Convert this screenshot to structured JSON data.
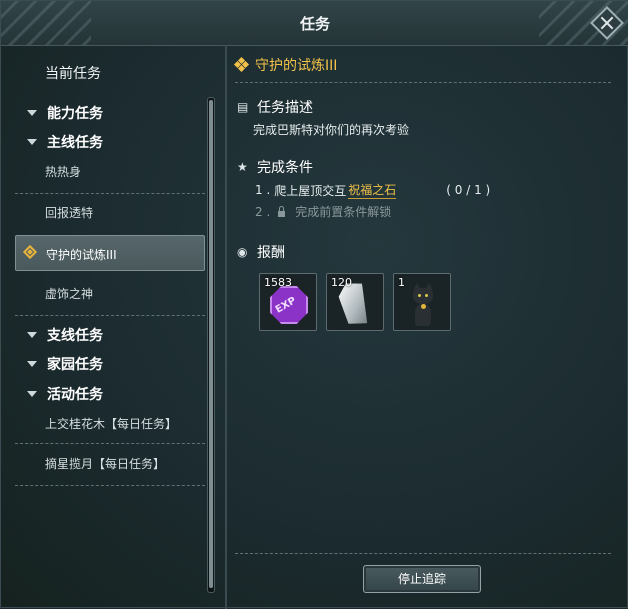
{
  "window": {
    "title": "任务"
  },
  "sidebar": {
    "current_label": "当前任务",
    "categories": [
      {
        "label": "能力任务"
      },
      {
        "label": "主线任务"
      },
      {
        "label": "支线任务"
      },
      {
        "label": "家园任务"
      },
      {
        "label": "活动任务"
      }
    ],
    "main_quests": [
      "热热身",
      "回报透特",
      "守护的试炼III",
      "虚饰之神"
    ],
    "event_quests": [
      "上交桂花木【每日任务】",
      "摘星揽月【每日任务】"
    ],
    "selected_index": 2
  },
  "detail": {
    "quest_title": "守护的试炼III",
    "description_header": "任务描述",
    "description": "完成巴斯特对你们的再次考验",
    "conditions_header": "完成条件",
    "conditions": [
      {
        "num": "1 .",
        "text": "爬上屋顶交互",
        "highlight": "祝福之石",
        "progress": "( 0 / 1 )"
      },
      {
        "num": "2 .",
        "text": "完成前置条件解锁"
      }
    ],
    "rewards_header": "报酬",
    "rewards": [
      {
        "count": "1583",
        "icon": "exp-icon",
        "exp_label": "EXP"
      },
      {
        "count": "120",
        "icon": "crystal-icon"
      },
      {
        "count": "1",
        "icon": "black-cat-icon"
      }
    ],
    "stop_button": "停止追踪"
  },
  "colors": {
    "accent_gold": "#f2c14a",
    "panel_bg": "#1b2a2e",
    "exp_purple": "#8b33c7"
  }
}
